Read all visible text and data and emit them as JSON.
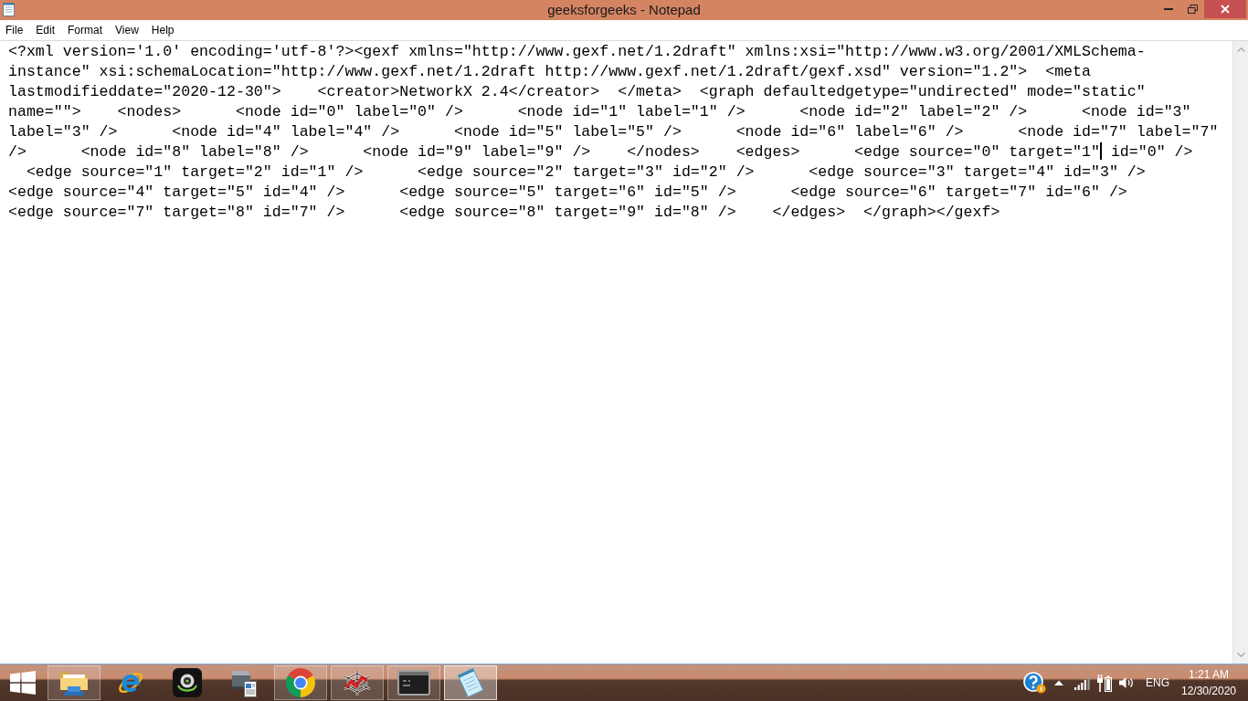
{
  "window": {
    "title": "geeksforgeeks - Notepad"
  },
  "menu_bar": [
    "File",
    "Edit",
    "Format",
    "View",
    "Help"
  ],
  "editor": {
    "lines": [
      {
        "text": "<?xml version='1.0' encoding='utf-8'?><gexf xmlns=\"http://www.gexf.net/1.2draft\" xmlns:xsi=\"http://www.w3.org/2001/XMLSchema-"
      },
      {
        "text": "instance\" xsi:schemaLocation=\"http://www.gexf.net/1.2draft http://www.gexf.net/1.2draft/gexf.xsd\" version=\"1.2\">  <meta"
      },
      {
        "text": "lastmodifieddate=\"2020-12-30\">    <creator>NetworkX 2.4</creator>  </meta>  <graph defaultedgetype=\"undirected\" mode=\"static\""
      },
      {
        "text": "name=\"\">    <nodes>      <node id=\"0\" label=\"0\" />      <node id=\"1\" label=\"1\" />      <node id=\"2\" label=\"2\" />      <node id=\"3\""
      },
      {
        "text": "label=\"3\" />      <node id=\"4\" label=\"4\" />      <node id=\"5\" label=\"5\" />      <node id=\"6\" label=\"6\" />      <node id=\"7\" label=\"7\""
      },
      {
        "text": "/>      <node id=\"8\" label=\"8\" />      <node id=\"9\" label=\"9\" />    </nodes>    <edges>      <edge source=\"0\" target=\"1\"",
        "after_cursor": " id=\"0\" />"
      },
      {
        "text": "  <edge source=\"1\" target=\"2\" id=\"1\" />      <edge source=\"2\" target=\"3\" id=\"2\" />      <edge source=\"3\" target=\"4\" id=\"3\" />"
      },
      {
        "text": "<edge source=\"4\" target=\"5\" id=\"4\" />      <edge source=\"5\" target=\"6\" id=\"5\" />      <edge source=\"6\" target=\"7\" id=\"6\" />"
      },
      {
        "text": "<edge source=\"7\" target=\"8\" id=\"7\" />      <edge source=\"8\" target=\"9\" id=\"8\" />    </edges>  </graph></gexf>"
      }
    ]
  },
  "taskbar": {
    "apps": [
      {
        "kind": "folder",
        "running": true,
        "selected": false
      },
      {
        "kind": "letter-e",
        "running": false,
        "selected": false
      },
      {
        "kind": "webcam",
        "running": false,
        "selected": false
      },
      {
        "kind": "scanner",
        "running": false,
        "selected": false
      },
      {
        "kind": "tricolor-circle",
        "running": true,
        "selected": false
      },
      {
        "kind": "spiderweb",
        "running": true,
        "selected": false
      },
      {
        "kind": "terminal",
        "running": true,
        "selected": false
      },
      {
        "kind": "notepad",
        "running": true,
        "selected": true
      }
    ],
    "tray": {
      "language": "ENG",
      "time": "1:21 AM",
      "date": "12/30/2020"
    }
  }
}
